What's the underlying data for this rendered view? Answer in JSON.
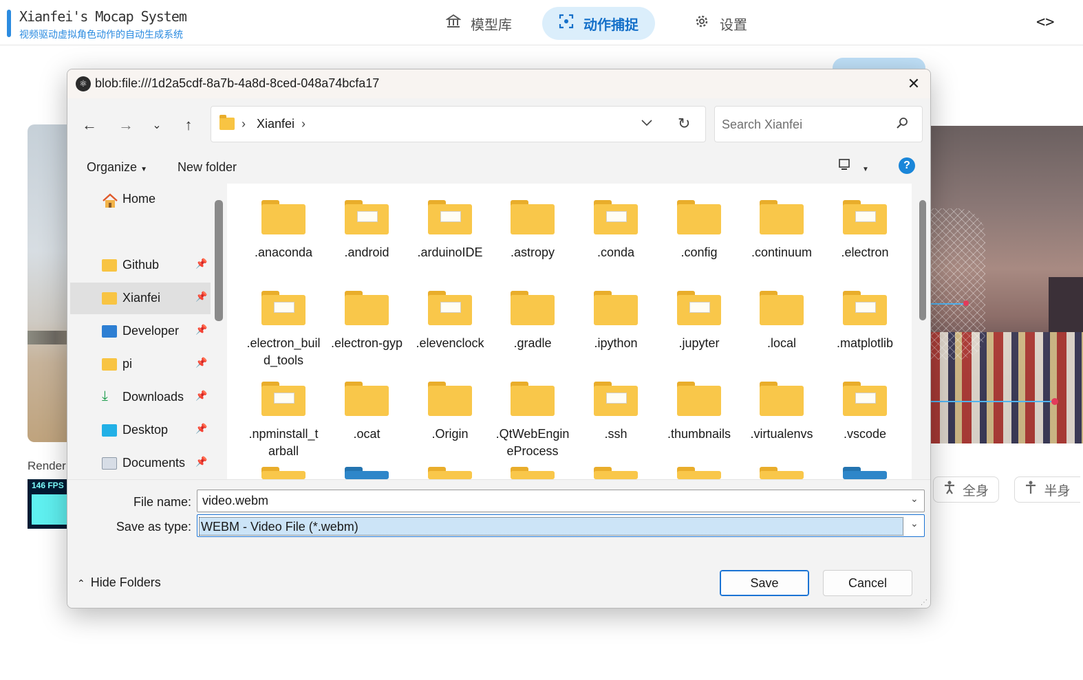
{
  "app": {
    "title": "Xianfei's Mocap System",
    "subtitle": "视频驱动虚拟角色动作的自动生成系统",
    "nav": [
      {
        "label": "模型库",
        "icon": "bank-icon"
      },
      {
        "label": "动作捕捉",
        "icon": "focus-icon",
        "active": true
      },
      {
        "label": "设置",
        "icon": "gear-icon"
      }
    ],
    "code_toggle": "<>",
    "render_label": "Render",
    "fps": "146 FPS",
    "pose_buttons": [
      "全身",
      "半身"
    ],
    "accent_color": "#2b8be0"
  },
  "dialog": {
    "title": "blob:file:///1d2a5cdf-8a7b-4a8d-8ced-048a74bcfa17",
    "address": {
      "crumb": "Xianfei"
    },
    "search_placeholder": "Search Xianfei",
    "commands": {
      "organize": "Organize",
      "new_folder": "New folder"
    },
    "nav_pane": [
      {
        "label": "Home",
        "icon": "home-icon",
        "pinned": false
      },
      {
        "label": "Github",
        "icon": "folder-icon",
        "pinned": true
      },
      {
        "label": "Xianfei",
        "icon": "folder-icon",
        "pinned": true,
        "selected": true
      },
      {
        "label": "Developer",
        "icon": "developer-folder-icon",
        "pinned": true
      },
      {
        "label": "pi",
        "icon": "folder-icon",
        "pinned": true
      },
      {
        "label": "Downloads",
        "icon": "download-icon",
        "pinned": true
      },
      {
        "label": "Desktop",
        "icon": "desktop-icon",
        "pinned": true
      },
      {
        "label": "Documents",
        "icon": "documents-icon",
        "pinned": true
      }
    ],
    "files": [
      {
        "name": ".anaconda",
        "has_content": false
      },
      {
        "name": ".android",
        "has_content": true
      },
      {
        "name": ".arduinoIDE",
        "has_content": true
      },
      {
        "name": ".astropy",
        "has_content": false
      },
      {
        "name": ".conda",
        "has_content": true
      },
      {
        "name": ".config",
        "has_content": false
      },
      {
        "name": ".continuum",
        "has_content": false
      },
      {
        "name": ".electron",
        "has_content": true
      },
      {
        "name": ".electron_build_tools",
        "has_content": true
      },
      {
        "name": ".electron-gyp",
        "has_content": false
      },
      {
        "name": ".elevenclock",
        "has_content": true
      },
      {
        "name": ".gradle",
        "has_content": false
      },
      {
        "name": ".ipython",
        "has_content": false
      },
      {
        "name": ".jupyter",
        "has_content": true
      },
      {
        "name": ".local",
        "has_content": false
      },
      {
        "name": ".matplotlib",
        "has_content": true
      },
      {
        "name": ".npminstall_tarball",
        "has_content": true
      },
      {
        "name": ".ocat",
        "has_content": false
      },
      {
        "name": ".Origin",
        "has_content": false
      },
      {
        "name": ".QtWebEngineProcess",
        "has_content": false
      },
      {
        "name": ".ssh",
        "has_content": true
      },
      {
        "name": ".thumbnails",
        "has_content": false
      },
      {
        "name": ".virtualenvs",
        "has_content": false
      },
      {
        "name": ".vscode",
        "has_content": true
      }
    ],
    "file_name_label": "File name:",
    "file_name_value": "video.webm",
    "save_type_label": "Save as type:",
    "save_type_value": "WEBM - Video File (*.webm)",
    "hide_folders": "Hide Folders",
    "save": "Save",
    "cancel": "Cancel"
  }
}
